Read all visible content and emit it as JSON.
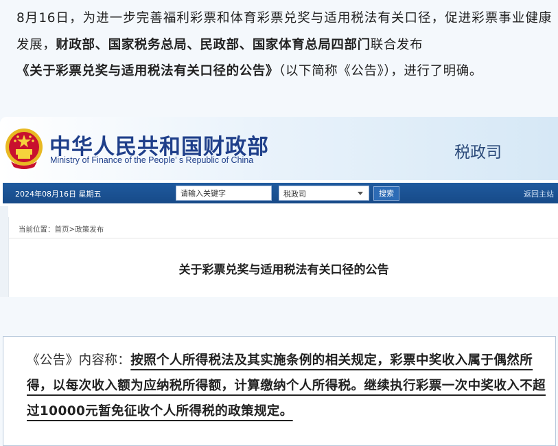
{
  "intro": {
    "p1": "8月16日，为进一步完善福利彩票和体育彩票兑奖与适用税法有关口径，促进彩票事业健康发展，",
    "departments": "财政部、国家税务总局、民政部、国家体育总局四部门",
    "p2": "联合发布",
    "announcement_title": "《关于彩票兑奖与适用税法有关口径的公告》",
    "p3": "（以下简称《公告》），进行了明确。"
  },
  "site": {
    "ministry_cn": "中华人民共和国财政部",
    "ministry_en": "Ministry of Finance of the People’ s Republic of China",
    "department": "税政司"
  },
  "navbar": {
    "date": "2024年08月16日  星期五",
    "search_placeholder": "请输入关键字",
    "select_value": "税政司",
    "search_button": "搜索",
    "back_link": "返回主站"
  },
  "content": {
    "breadcrumb": "当前位置：首页>政策发布",
    "title": "关于彩票兑奖与适用税法有关口径的公告"
  },
  "quote": {
    "lead": "《公告》内容称：",
    "text": "按照个人所得税法及其实施条例的相关规定，彩票中奖收入属于偶然所得，以每次收入额为应纳税所得额，计算缴纳个人所得税。继续执行彩票一次中奖收入不超过10000元暂免征收个人所得税的政策规定。"
  },
  "colors": {
    "navbar": "#1f5a9e",
    "ministry_text": "#1f3f8a",
    "emblem_red": "#c8102e",
    "emblem_gold": "#e8b923"
  }
}
